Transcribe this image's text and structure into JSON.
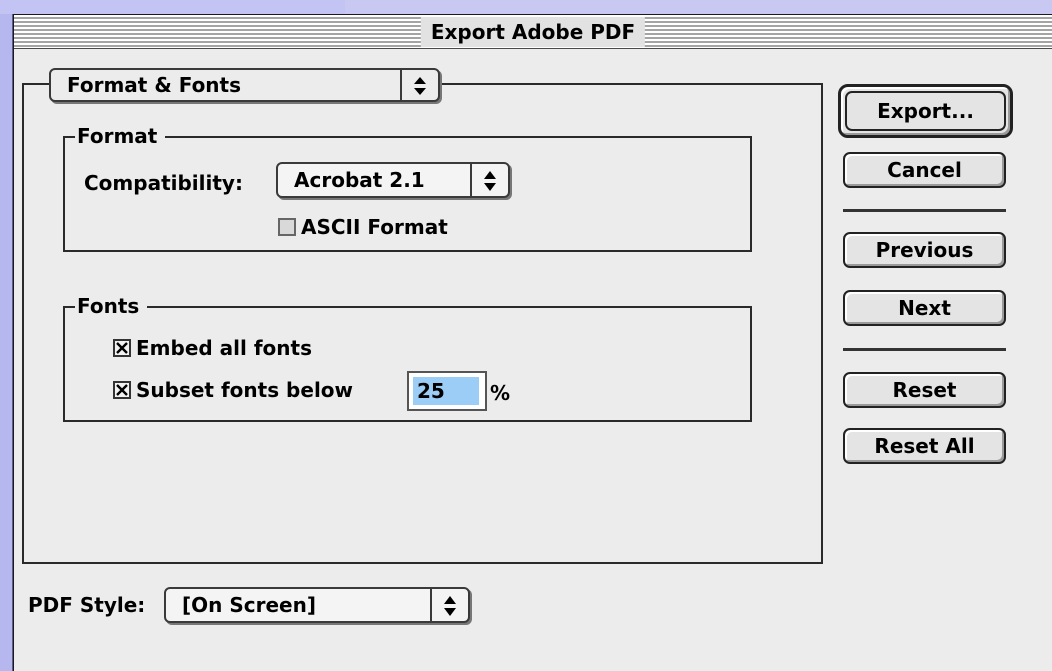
{
  "window": {
    "title": "Export Adobe PDF"
  },
  "panel": {
    "selector": {
      "value": "Format & Fonts",
      "icon": "up-down-arrows-icon"
    },
    "format_group": {
      "legend": "Format",
      "compatibility_label": "Compatibility:",
      "compatibility_value": "Acrobat 2.1",
      "ascii_label": "ASCII Format",
      "ascii_checked": false
    },
    "fonts_group": {
      "legend": "Fonts",
      "embed_label": "Embed all fonts",
      "embed_checked": true,
      "subset_label": "Subset fonts below",
      "subset_checked": true,
      "subset_value": "25",
      "subset_unit": "%"
    }
  },
  "pdf_style": {
    "label": "PDF Style:",
    "value": "[On Screen]"
  },
  "buttons": {
    "export": "Export...",
    "cancel": "Cancel",
    "previous": "Previous",
    "next": "Next",
    "reset": "Reset",
    "reset_all": "Reset All"
  },
  "colors": {
    "desktop": "#c8c8f2",
    "dialog": "#ececec",
    "selection": "#9ccdf6"
  }
}
